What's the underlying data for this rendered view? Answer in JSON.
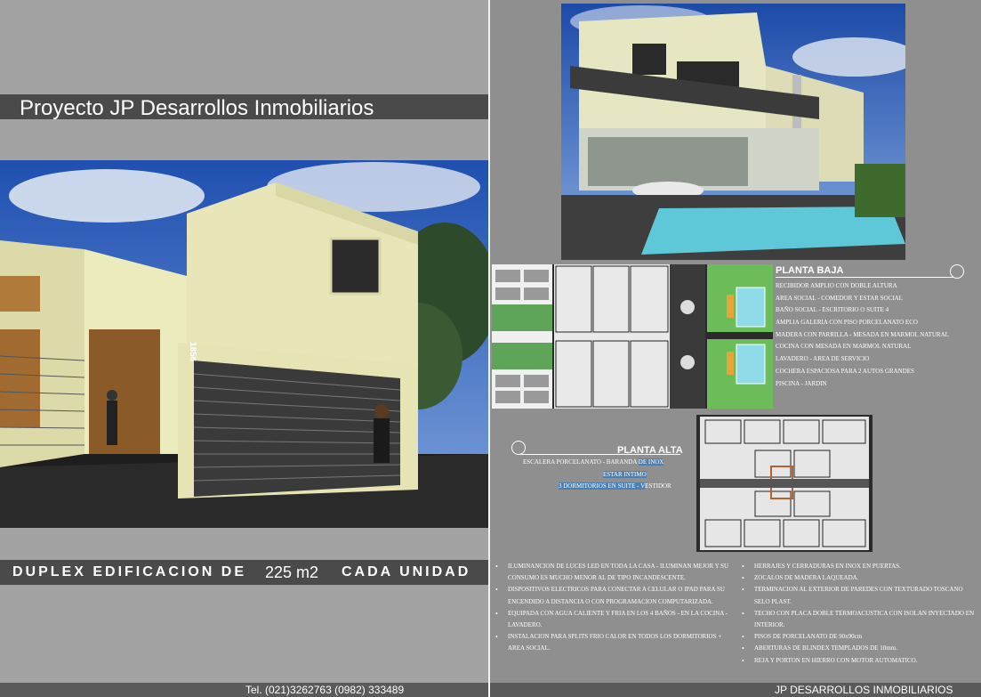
{
  "project_title": "Proyecto JP Desarrollos Inmobiliarios",
  "house_number": "1856",
  "headline": {
    "part1": "DUPLEX EDIFICACION DE",
    "area": "225 m2",
    "part2": "CADA UNIDAD"
  },
  "contact": "Tel. (021)3262763 (0982) 333489",
  "brand_footer": "JP DESARROLLOS INMOBILIARIOS",
  "planta_baja": {
    "title": "PLANTA BAJA",
    "items": [
      "RECIBIDOR AMPLIO CON DOBLE ALTURA",
      "AREA SOCIAL -  COMEDOR Y ESTAR SOCIAL",
      "BAÑO SOCIAL -  ESCRITORIO O SUITE 4",
      "AMPLIA GALERIA CON PISO PORCELANATO ECO",
      "MADERA CON PARRILLA -  MESADA EN MARMOL NATURAL",
      "COCINA CON MESADA EN MARMOL NATURAL",
      "LAVADERO -  AREA DE SERVICIO",
      "COCHERA ESPACIOSA PARA 2 AUTOS GRANDES",
      "PISCINA -  JARDIN"
    ]
  },
  "planta_alta": {
    "title": "PLANTA ALTA",
    "line1": "ESCALERA PORCELANATO - BARANDA ",
    "line1_hl": "DE INOX",
    "line2_hl": "ESTAR INTIMO",
    "line3_hl": "3 DORMITORIOS EN SUITE - V",
    "line3": "ESTIDOR"
  },
  "features_left": [
    "ILUMINANCION DE LUCES LED EN TODA LA CASA - ILUMINAN MEJOR Y SU CONSUMO ES MUCHO MENOR AL DE TIPO INCANDESCENTE.",
    "DISPOSITIVOS ELECTRICOS PARA CONECTAR A CELULAR O  IPAD PARA SU ENCENDIDO A DISTANCIA O CON PROGRAMACION COMPUTARIZADA.",
    "EQUIPADA CON AGUA CALIENTE Y FRIA EN LOS 4 BAÑOS - EN LA COCINA -  LAVADERO.",
    "INSTALACION PARA SPLITS FRIO CALOR EN TODOS LOS DORMITORIOS + AREA SOCIAL."
  ],
  "features_right": [
    "HERRAJES Y CERRADURAS EN INOX EN PUERTAS.",
    "ZOCALOS DE MADERA LAQUEADA.",
    "TERMINACION AL EXTERIOR DE PAREDES CON TEXTURADO TOSCANO SELO PLAST.",
    "TECHO CON PLACA DOBLE TERMOACUSTICA CON ISOLAN INYECTADO EN INTERIOR.",
    "PISOS DE PORCELANATO DE 90x90cm",
    "ABERTURAS DE BLINDEX TEMPLADOS DE 10mm.",
    "REJA Y PORTON EN HIERRO CON MOTOR AUTOMATICO."
  ]
}
